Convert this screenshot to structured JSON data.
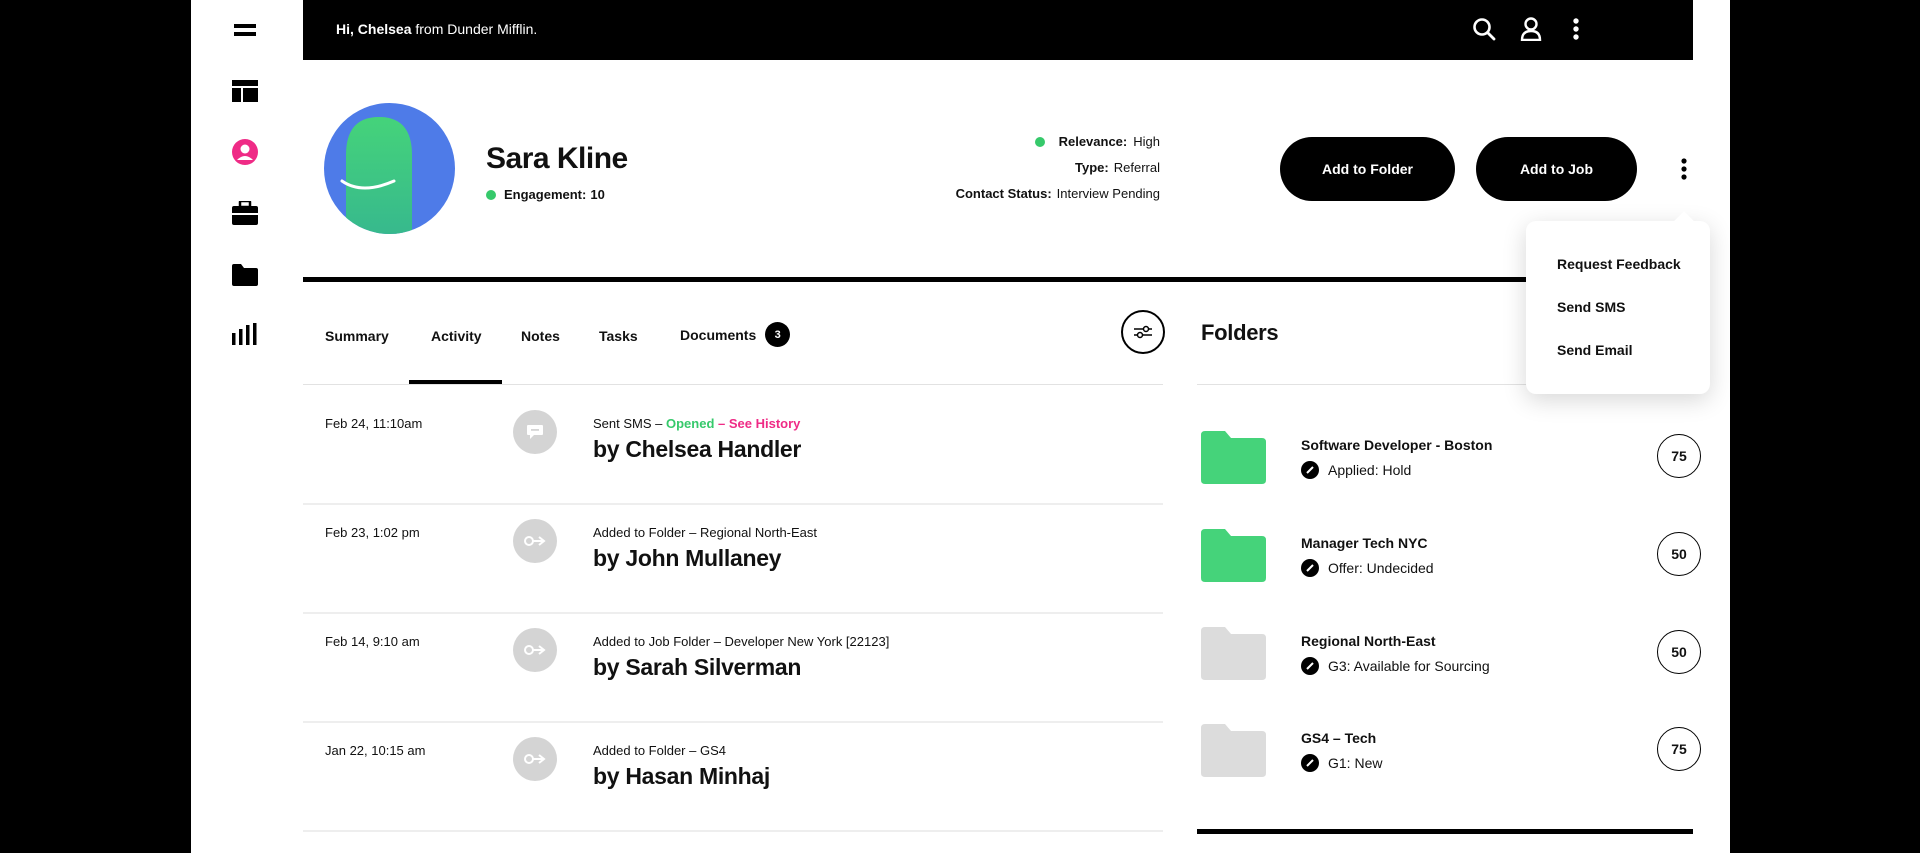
{
  "topbar": {
    "greeting_name": "Hi, Chelsea",
    "greeting_rest": " from Dunder Mifflin."
  },
  "sidebar": {
    "items": [
      {
        "icon": "menu-icon"
      },
      {
        "icon": "dashboard-icon"
      },
      {
        "icon": "candidate-icon",
        "active": true
      },
      {
        "icon": "briefcase-icon"
      },
      {
        "icon": "folder-icon"
      },
      {
        "icon": "analytics-icon"
      }
    ]
  },
  "profile": {
    "name": "Sara Kline",
    "engagement_label": "Engagement:",
    "engagement_value": "10",
    "relevance_label": "Relevance:",
    "relevance_value": "High",
    "type_label": "Type:",
    "type_value": "Referral",
    "contact_status_label": "Contact Status:",
    "contact_status_value": "Interview Pending"
  },
  "actions": {
    "add_to_folder": "Add to Folder",
    "add_to_job": "Add to Job"
  },
  "menu": {
    "items": [
      "Request Feedback",
      "Send SMS",
      "Send Email"
    ]
  },
  "tabs": {
    "summary": "Summary",
    "activity": "Activity",
    "notes": "Notes",
    "tasks": "Tasks",
    "documents": "Documents",
    "documents_count": "3",
    "active": "Activity"
  },
  "activity": [
    {
      "date": "Feb 24, 11:10am",
      "icon": "sms-icon",
      "text": "Sent SMS – ",
      "opened": "Opened",
      "sep": " – ",
      "history": "See History",
      "by": "by Chelsea Handler"
    },
    {
      "date": "Feb 23, 1:02 pm",
      "icon": "move-icon",
      "text": "Added to Folder – Regional North-East",
      "by": "by John Mullaney"
    },
    {
      "date": "Feb 14, 9:10 am",
      "icon": "move-icon",
      "text": "Added to Job Folder – Developer New York [22123]",
      "by": "by Sarah Silverman"
    },
    {
      "date": "Jan 22, 10:15 am",
      "icon": "move-icon",
      "text": "Added to Folder – GS4",
      "by": "by Hasan Minhaj"
    }
  ],
  "folders": {
    "title": "Folders",
    "items": [
      {
        "name": "Software Developer - Boston",
        "status": "Applied: Hold",
        "score": "75",
        "color": "#45d37a"
      },
      {
        "name": "Manager Tech NYC",
        "status": "Offer: Undecided",
        "score": "50",
        "color": "#45d37a"
      },
      {
        "name": "Regional North-East",
        "status": "G3: Available for Sourcing",
        "score": "50",
        "color": "#dcdcdc"
      },
      {
        "name": "GS4 – Tech",
        "status": "G1: New",
        "score": "75",
        "color": "#dcdcdc"
      }
    ]
  },
  "colors": {
    "accent_green": "#36c96b",
    "accent_pink": "#ef2b86",
    "avatar_blue": "#4e7be8"
  }
}
